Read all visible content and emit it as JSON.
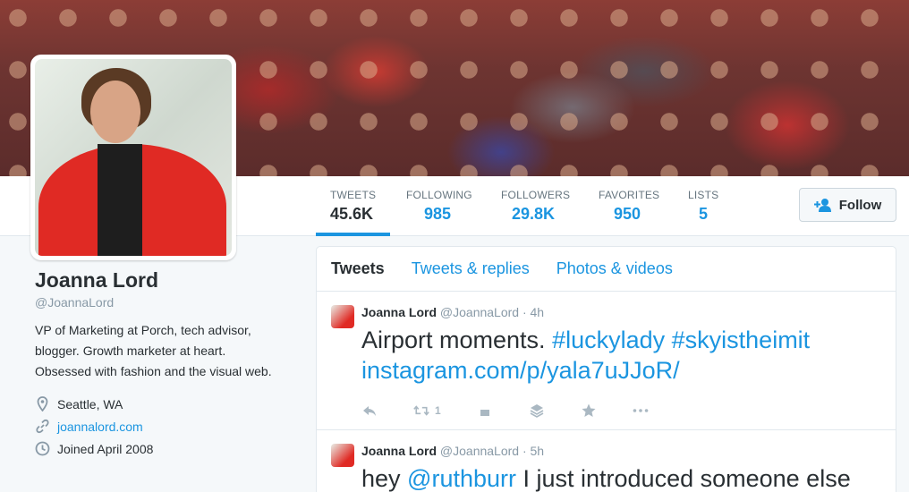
{
  "profile": {
    "name": "Joanna Lord",
    "handle": "@JoannaLord",
    "bio": "VP of Marketing at Porch, tech advisor, blogger. Growth marketer at heart. Obsessed with fashion and the visual web.",
    "location": "Seattle, WA",
    "website": "joannalord.com",
    "joined": "Joined April 2008"
  },
  "stats": {
    "tweets_label": "TWEETS",
    "tweets_value": "45.6K",
    "following_label": "FOLLOWING",
    "following_value": "985",
    "followers_label": "FOLLOWERS",
    "followers_value": "29.8K",
    "favorites_label": "FAVORITES",
    "favorites_value": "950",
    "lists_label": "LISTS",
    "lists_value": "5"
  },
  "follow_button": {
    "label": "Follow"
  },
  "tabs": [
    "Tweets",
    "Tweets & replies",
    "Photos & videos"
  ],
  "tweets": [
    {
      "name": "Joanna Lord",
      "handle": "@JoannaLord",
      "time": "· 4h",
      "text_plain": "Airport moments. ",
      "hashtag1": "#luckylady",
      "hashtag2": "#skyistheimit",
      "link": "instagram.com/p/yala7uJJoR/",
      "retweets": "1"
    },
    {
      "name": "Joanna Lord",
      "handle": "@JoannaLord",
      "time": "· 5h",
      "text_pre": "hey ",
      "mention": "@ruthburr",
      "text_post": " I just introduced someone else"
    }
  ],
  "colors": {
    "accent": "#1b95e0",
    "text": "#292f33",
    "muted": "#8899a6"
  }
}
